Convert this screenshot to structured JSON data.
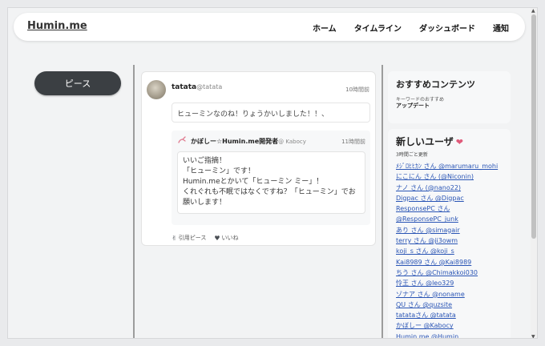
{
  "navbar": {
    "brand": "Humin.me",
    "links": [
      "ホーム",
      "タイムライン",
      "ダッシュボード",
      "通知"
    ]
  },
  "left": {
    "peace_button": "ピース"
  },
  "post": {
    "user_name": "tatata",
    "user_handle": "@tatata",
    "time": "10時間前",
    "body": "ヒューミンなのね！りょうかいしました！！、",
    "quote": {
      "user_name": "かぼしー☆Humin.me開発者",
      "user_handle": "@ Kabocy",
      "time": "11時間前",
      "lines": [
        "いいご指摘！",
        "「ヒューミン」です！",
        "Humin.meとかいて「ヒューミン ミー」！",
        "くれぐれも不眠ではなくですね？「ヒューミン」でお",
        "願いします！"
      ]
    },
    "actions": {
      "quote_peace": "引用ピース",
      "like": "いいね"
    }
  },
  "recommended": {
    "title": "おすすめコンテンツ",
    "subtitle": "キーワードのおすすめ",
    "item": "アップデート"
  },
  "new_users": {
    "title": "新しいユーザ",
    "subtitle": "3時間ごと更新",
    "items": [
      "ﾒｼﾞﾛﾋﾋｶﾝ さん @marumaru_mohi",
      "にこにん さん (@Niconin)",
      "ナノ さん (@nano22)",
      "Digpac さん @Digpac",
      "ResponsePC さん",
      "@ResponsePC_junk",
      "あり さん @simagair",
      "terry さん @ji3owm",
      "koji_s さん @koji_s",
      "Kai8989 さん @Kai8989",
      "ちう さん @Chimakkoi030",
      "怜王 さん @leo329",
      "ゾナア さん @noname",
      "QU さん @quzsite",
      "tatataさん @tatata",
      "かぼしー @Kabocy",
      "Humin.me @Humin"
    ]
  },
  "colors": {
    "accent_button": "#3b3f43",
    "link": "#2a55b5"
  }
}
